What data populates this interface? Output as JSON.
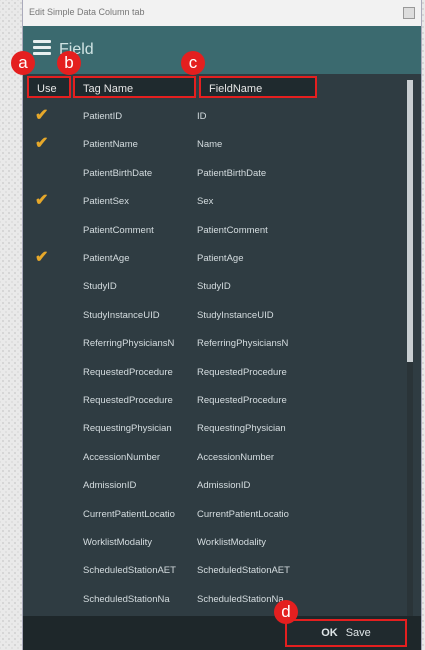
{
  "window": {
    "title": "Edit Simple Data Column tab"
  },
  "header": {
    "title": "Field"
  },
  "columns": {
    "use": "Use",
    "tag_name": "Tag Name",
    "field_name": "FieldName"
  },
  "rows": [
    {
      "checked": true,
      "tag": "PatientID",
      "field": "ID"
    },
    {
      "checked": true,
      "tag": "PatientName",
      "field": "Name"
    },
    {
      "checked": false,
      "tag": "PatientBirthDate",
      "field": "PatientBirthDate"
    },
    {
      "checked": true,
      "tag": "PatientSex",
      "field": "Sex"
    },
    {
      "checked": false,
      "tag": "PatientComment",
      "field": "PatientComment"
    },
    {
      "checked": true,
      "tag": "PatientAge",
      "field": "PatientAge"
    },
    {
      "checked": false,
      "tag": "StudyID",
      "field": "StudyID"
    },
    {
      "checked": false,
      "tag": "StudyInstanceUID",
      "field": "StudyInstanceUID"
    },
    {
      "checked": false,
      "tag": "ReferringPhysiciansN",
      "field": "ReferringPhysiciansN"
    },
    {
      "checked": false,
      "tag": "RequestedProcedure",
      "field": "RequestedProcedure"
    },
    {
      "checked": false,
      "tag": "RequestedProcedure",
      "field": "RequestedProcedure"
    },
    {
      "checked": false,
      "tag": "RequestingPhysician",
      "field": "RequestingPhysician"
    },
    {
      "checked": false,
      "tag": "AccessionNumber",
      "field": "AccessionNumber"
    },
    {
      "checked": false,
      "tag": "AdmissionID",
      "field": "AdmissionID"
    },
    {
      "checked": false,
      "tag": "CurrentPatientLocatio",
      "field": "CurrentPatientLocatio"
    },
    {
      "checked": false,
      "tag": "WorklistModality",
      "field": "WorklistModality"
    },
    {
      "checked": false,
      "tag": "ScheduledStationAET",
      "field": "ScheduledStationAET"
    },
    {
      "checked": false,
      "tag": "ScheduledStationNa",
      "field": "ScheduledStationNa"
    }
  ],
  "footer": {
    "ok_label": "OK",
    "save_label": "Save"
  },
  "annotations": {
    "a": "a",
    "b": "b",
    "c": "c",
    "d": "d"
  },
  "colors": {
    "accent_check": "#e6a82a",
    "highlight": "#e41f1f",
    "header_bg": "#3b6a6f",
    "window_bg": "#2f3c42"
  },
  "icons": {
    "menu": "hamburger-menu-icon",
    "check": "checkmark-icon"
  }
}
